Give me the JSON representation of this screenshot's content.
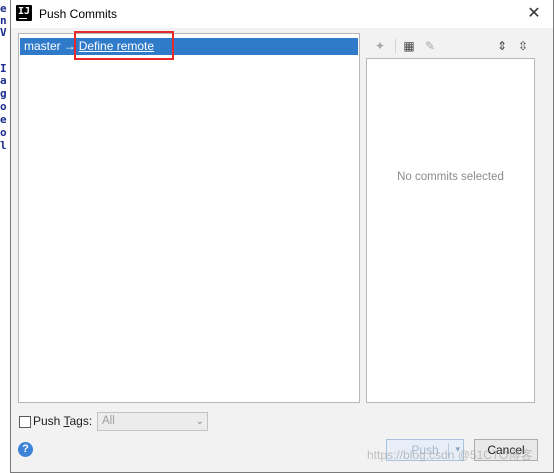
{
  "background_editor": {
    "chars": [
      "e",
      "n",
      "V",
      "",
      "I",
      "a",
      "g",
      "o",
      "e",
      "o",
      "l"
    ]
  },
  "dialog": {
    "app_icon_letter": "IJ",
    "title": "Push Commits",
    "close_glyph": "✕"
  },
  "push_list": {
    "branch": "master",
    "arrow": "→",
    "remote_link": "Define remote"
  },
  "toolbar": {
    "icons": [
      "expand-all-icon",
      "group-by-icon",
      "edit-icon",
      "expand-icon",
      "collapse-icon"
    ]
  },
  "details": {
    "empty_text": "No commits selected"
  },
  "push_tags": {
    "label_prefix": "Push ",
    "label_mnemonic": "T",
    "label_suffix": "ags:",
    "checked": false,
    "select_value": "All"
  },
  "buttons": {
    "help": "?",
    "push": "Push",
    "cancel": "Cancel"
  },
  "watermark": "https://blog.csdn @51CTO博客",
  "colors": {
    "selection": "#2f7bc9",
    "highlight_box": "#e8292b",
    "help_icon": "#3c82d7"
  }
}
